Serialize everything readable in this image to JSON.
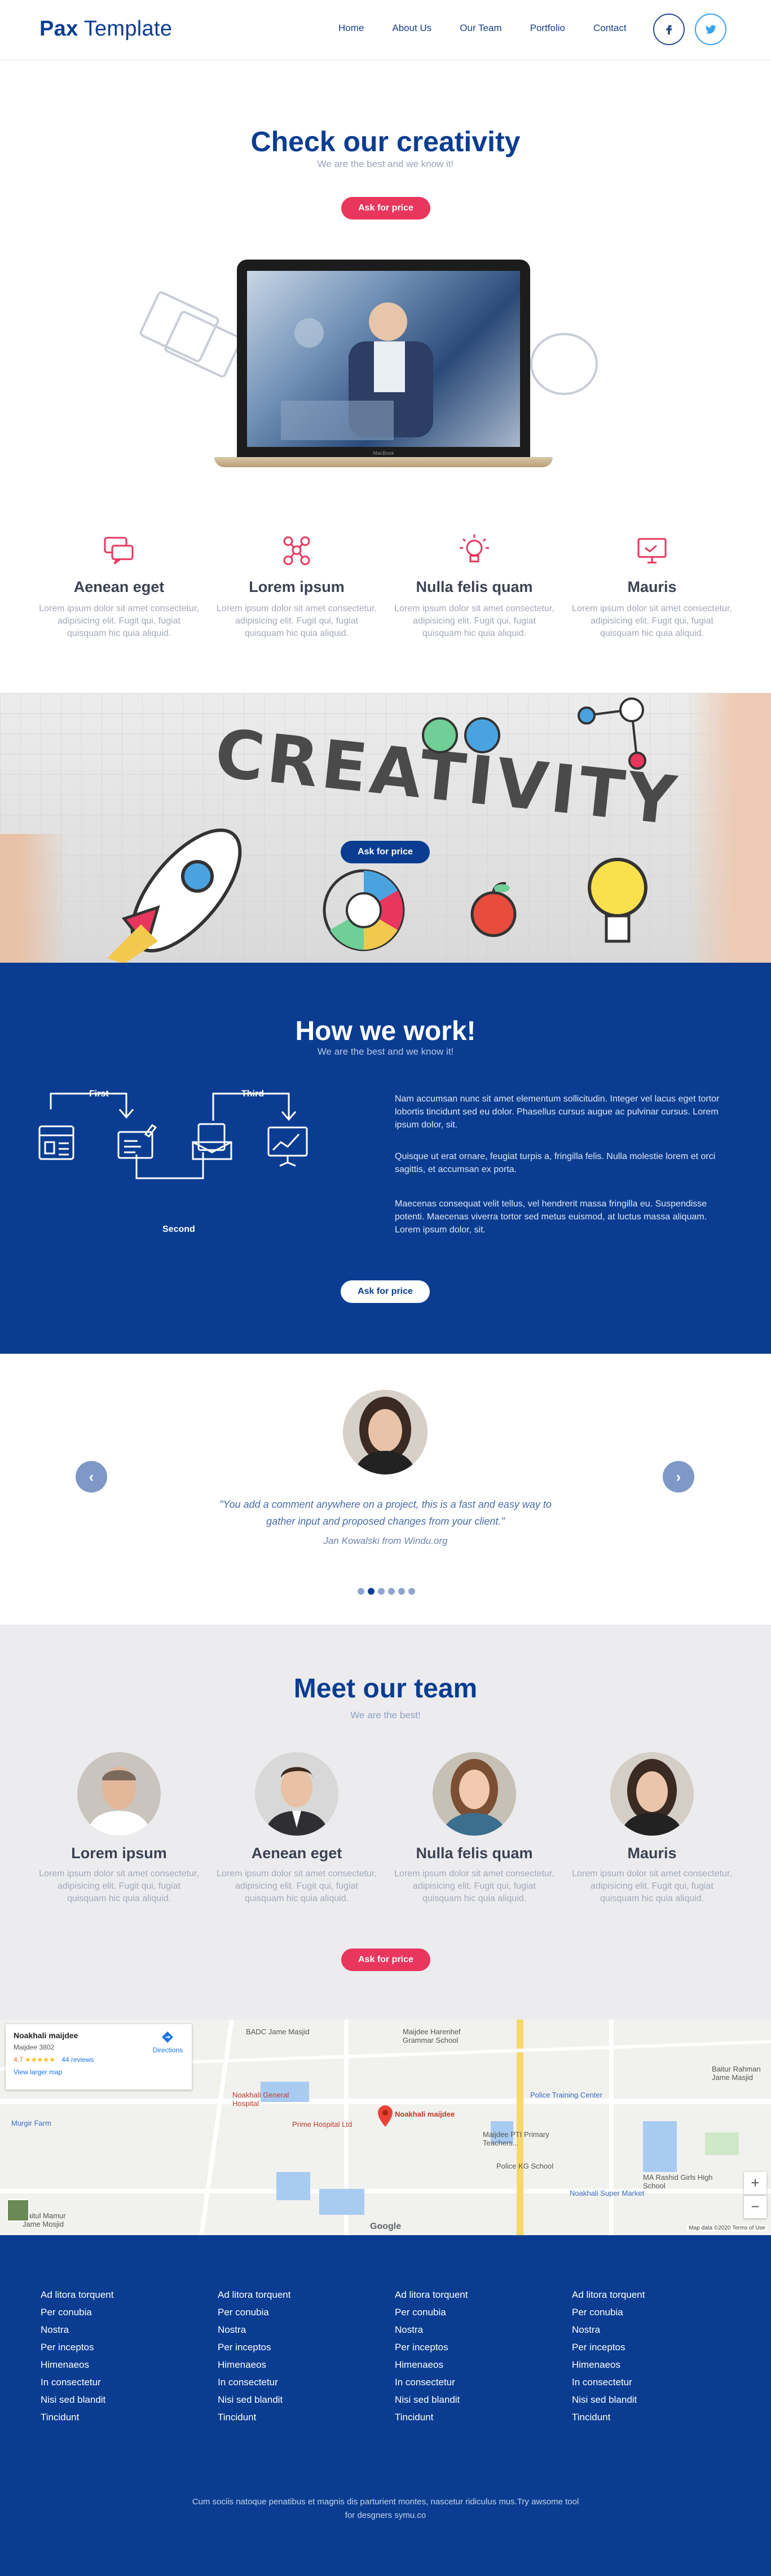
{
  "header": {
    "logo_bold": "Pax",
    "logo_light": "Template",
    "nav": [
      "Home",
      "About Us",
      "Our Team",
      "Portfolio",
      "Contact"
    ],
    "social": [
      {
        "icon": "facebook-icon",
        "glyph": "f",
        "color": "#2a4a8c"
      },
      {
        "icon": "twitter-icon",
        "glyph": "t",
        "color": "#38a1f3"
      }
    ]
  },
  "hero": {
    "title": "Check our creativity",
    "subtitle": "We are the best and we know it!",
    "cta": "Ask for price",
    "laptop_brand": "MacBook"
  },
  "features": [
    {
      "icon": "chat-icon",
      "title": "Aenean eget",
      "text": "Lorem ipsum dolor sit amet consectetur, adipisicing elit. Fugit qui, fugiat quisquam hic quia aliquid."
    },
    {
      "icon": "network-icon",
      "title": "Lorem ipsum",
      "text": "Lorem ipsum dolor sit amet consectetur, adipisicing elit. Fugit qui, fugiat quisquam hic quia aliquid."
    },
    {
      "icon": "lightbulb-icon",
      "title": "Nulla felis quam",
      "text": "Lorem ipsum dolor sit amet consectetur, adipisicing elit. Fugit qui, fugiat quisquam hic quia aliquid."
    },
    {
      "icon": "monitor-icon",
      "title": "Mauris",
      "text": "Lorem ipsum dolor sit amet consectetur, adipisicing elit. Fugit qui, fugiat quisquam hic quia aliquid."
    }
  ],
  "banner": {
    "word": "CREATIVITY",
    "cta": "Ask for price"
  },
  "how": {
    "title": "How we work!",
    "subtitle": "We are the best and we know it!",
    "steps": {
      "first": "First",
      "second": "Second",
      "third": "Third"
    },
    "paragraphs": [
      "Nam accumsan nunc sit amet elementum sollicitudin. Integer vel lacus eget tortor lobortis tincidunt sed eu dolor. Phasellus cursus augue ac pulvinar cursus. Lorem ipsum dolor, sit.",
      "Quisque ut erat ornare, feugiat turpis a, fringilla felis. Nulla molestie lorem et orci sagittis, et accumsan ex porta.",
      "Maecenas consequat velit tellus, vel hendrerit massa fringilla eu. Suspendisse potenti. Maecenas viverra tortor sed metus euismod, at luctus massa aliquam. Lorem ipsum dolor, sit."
    ],
    "cta": "Ask for price"
  },
  "testimonial": {
    "quote": "\"You add a comment anywhere on a project, this is a fast and easy way to gather input and proposed changes from your client.\"",
    "author": "Jan Kowalski from Windu.org",
    "prev": "‹",
    "next": "›",
    "dots": 6,
    "active_dot": 1
  },
  "team": {
    "title": "Meet our team",
    "subtitle": "We are the best!",
    "members": [
      {
        "name": "Lorem ipsum",
        "text": "Lorem ipsum dolor sit amet consectetur, adipisicing elit. Fugit qui, fugiat quisquam hic quia aliquid."
      },
      {
        "name": "Aenean eget",
        "text": "Lorem ipsum dolor sit amet consectetur, adipisicing elit. Fugit qui, fugiat quisquam hic quia aliquid."
      },
      {
        "name": "Nulla felis quam",
        "text": "Lorem ipsum dolor sit amet consectetur, adipisicing elit. Fugit qui, fugiat quisquam hic quia aliquid."
      },
      {
        "name": "Mauris",
        "text": "Lorem ipsum dolor sit amet consectetur, adipisicing elit. Fugit qui, fugiat quisquam hic quia aliquid."
      }
    ],
    "cta": "Ask for price"
  },
  "map": {
    "place": "Noakhali maijdee",
    "address": "Maijdee 3802",
    "rating": "4.7",
    "stars": "★★★★★",
    "reviews": "44 reviews",
    "directions": "Directions",
    "larger": "View larger map",
    "pin_label": "Noakhali maijdee",
    "labels": [
      "BADC Jame Masjid",
      "Maijdee Harenhef Grammar School",
      "Noakhali General Hospital",
      "Prime Hospital Ltd",
      "Police Training Center",
      "Maijdee PTI Primary Teachers...",
      "Police KG School",
      "Noakhali Super Market",
      "MA Rashid Girls High School",
      "Murgir Farm",
      "Baitul Mamur Jame Mosjid",
      "Baitur Rahman Jame Masjid"
    ],
    "google": "Google",
    "footer_note": "Map data ©2020   Terms of Use",
    "zoom_in": "+",
    "zoom_out": "−"
  },
  "footer": {
    "columns": [
      [
        "Ad litora torquent",
        "Per conubia",
        "Nostra",
        "Per inceptos",
        "Himenaeos",
        "In consectetur",
        "Nisi sed blandit",
        "Tincidunt"
      ],
      [
        "Ad litora torquent",
        "Per conubia",
        "Nostra",
        "Per inceptos",
        "Himenaeos",
        "In consectetur",
        "Nisi sed blandit",
        "Tincidunt"
      ],
      [
        "Ad litora torquent",
        "Per conubia",
        "Nostra",
        "Per inceptos",
        "Himenaeos",
        "In consectetur",
        "Nisi sed blandit",
        "Tincidunt"
      ],
      [
        "Ad litora torquent",
        "Per conubia",
        "Nostra",
        "Per inceptos",
        "Himenaeos",
        "In consectetur",
        "Nisi sed blandit",
        "Tincidunt"
      ]
    ],
    "copyright": "Cum sociis natoque penatibus et magnis dis parturient montes, nascetur ridiculus mus.Try awsome tool for desgners symu.co"
  },
  "colors": {
    "brand": "#0a3d91",
    "accent": "#e8365d"
  }
}
